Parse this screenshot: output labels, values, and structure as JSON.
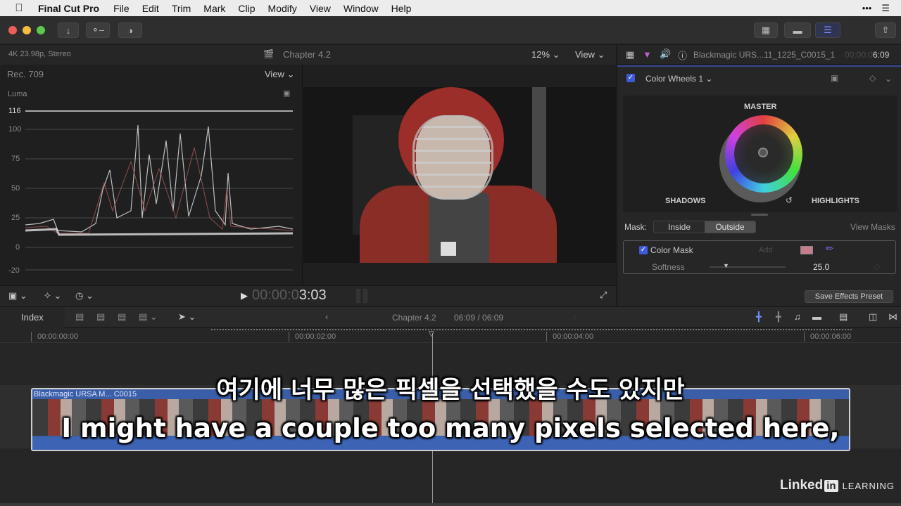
{
  "menubar": {
    "app_name": "Final Cut Pro",
    "items": [
      "File",
      "Edit",
      "Trim",
      "Mark",
      "Clip",
      "Modify",
      "View",
      "Window",
      "Help"
    ]
  },
  "viewer": {
    "format": "4K 23.98p, Stereo",
    "title": "Chapter 4.2",
    "zoom": "12%",
    "view_label": "View",
    "timecode_dim": "00:00:0",
    "timecode_bright": "3:03"
  },
  "scopes": {
    "colorspace": "Rec. 709",
    "view_label": "View",
    "mode": "Luma",
    "ticks": [
      "116",
      "100",
      "75",
      "50",
      "25",
      "0",
      "-20"
    ]
  },
  "inspector": {
    "clip_name": "Blackmagic URS...11_1225_C0015_1",
    "timecode_dim": "00:00:0",
    "timecode_bright": "6:09",
    "effect_name": "Color Wheels 1",
    "wheel_master": "MASTER",
    "wheel_shadows": "SHADOWS",
    "wheel_highlights": "HIGHLIGHTS",
    "mask_label": "Mask:",
    "mask_inside": "Inside",
    "mask_outside": "Outside",
    "view_masks": "View Masks",
    "color_mask_label": "Color Mask",
    "add_label": "Add",
    "softness_label": "Softness",
    "softness_value": "25.0",
    "save_preset": "Save Effects Preset"
  },
  "timeline": {
    "index_label": "Index",
    "title": "Chapter 4.2",
    "position": "06:09 / 06:09",
    "ruler": [
      "00:00:00:00",
      "00:00:02:00",
      "00:00:04:00",
      "00:00:06:00"
    ],
    "clip_label": "Blackmagic URSA M... C0015"
  },
  "subtitles": {
    "korean": "여기에 너무 많은 픽셀을 선택했을 수도 있지만",
    "english": "I might have a couple too many pixels selected here,"
  },
  "watermark": {
    "brand": "Linked",
    "brand_in": "in",
    "suffix": "LEARNING"
  },
  "colors": {
    "accent": "#3d5bd9",
    "close": "#ec5f58",
    "minimize": "#f4bd40",
    "zoom": "#5ec84a",
    "clip_blue": "#3a5fa8"
  }
}
